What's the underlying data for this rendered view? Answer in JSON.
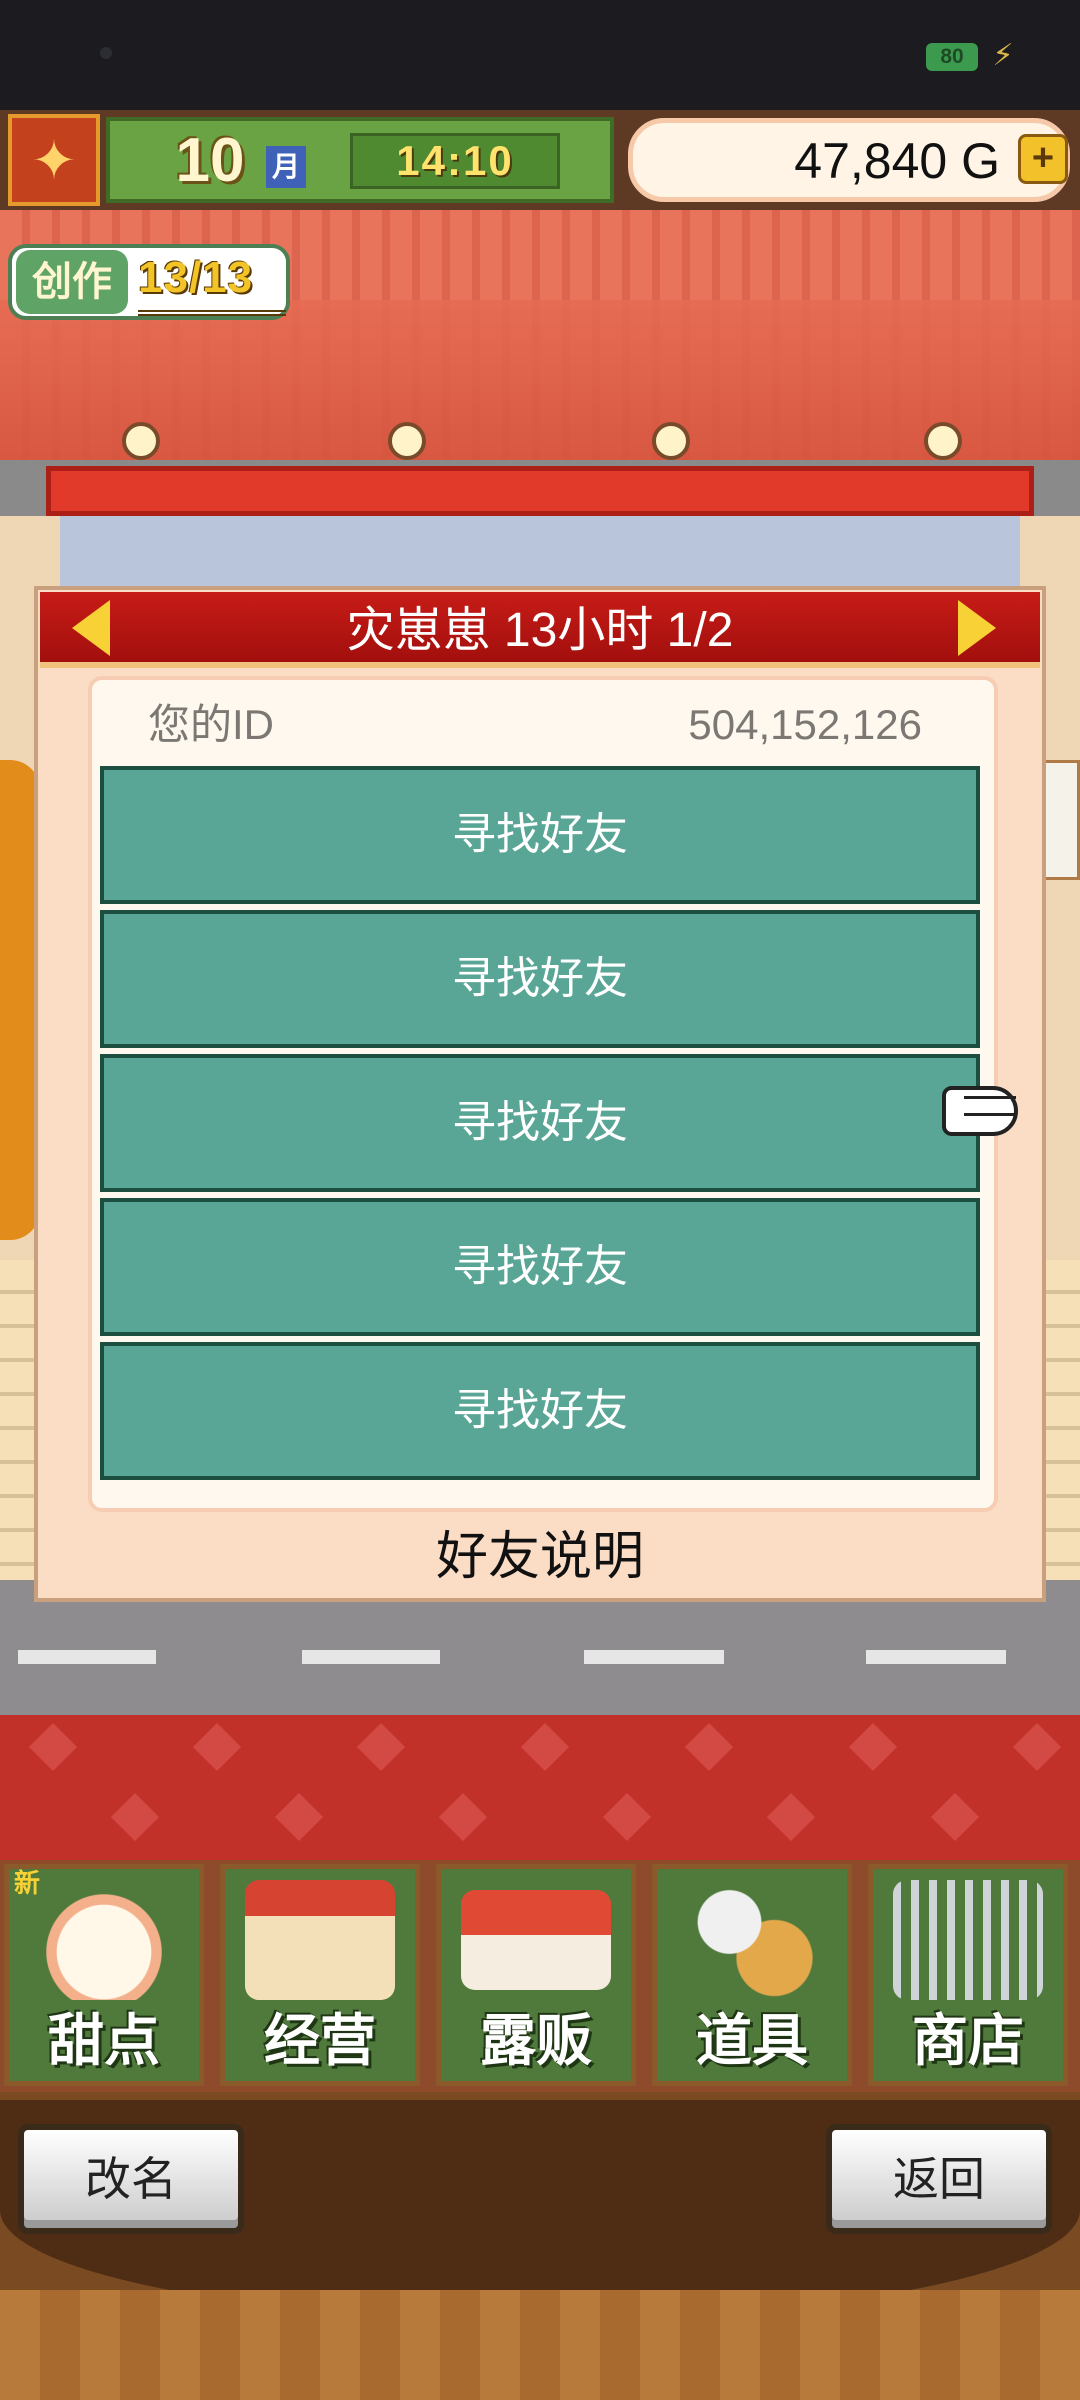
{
  "status_bar": {
    "battery_level": "80",
    "charging_icon": "lightning-icon"
  },
  "hud": {
    "season_icon": "maple-leaf-icon",
    "month_number": "10",
    "month_label": "月",
    "time": "14:10",
    "gold": "47,840 G",
    "add_gold_icon": "plus-icon"
  },
  "craft_counter": {
    "label": "创作",
    "value": "13/13"
  },
  "friend_panel": {
    "title": "灾崽崽  13小时 1/2",
    "prev_icon": "arrow-left-icon",
    "next_icon": "arrow-right-icon",
    "id_label": "您的ID",
    "id_value": "504,152,126",
    "slots": [
      "寻找好友",
      "寻找好友",
      "寻找好友",
      "寻找好友",
      "寻找好友"
    ],
    "help_label": "好友说明"
  },
  "pointer_icon": "pointing-hand-icon",
  "bottom_menu": {
    "new_badge": "新",
    "items": [
      {
        "label": "甜点",
        "icon": "cake-icon"
      },
      {
        "label": "经营",
        "icon": "shop-icon"
      },
      {
        "label": "露贩",
        "icon": "food-truck-icon"
      },
      {
        "label": "道具",
        "icon": "item-bag-icon"
      },
      {
        "label": "商店",
        "icon": "shopping-cart-icon"
      }
    ]
  },
  "footer": {
    "rename_label": "改名",
    "back_label": "返回"
  },
  "colors": {
    "panel_header": "#c71c17",
    "slot_fill": "#5aa696",
    "menu_tile": "#4f7a3c"
  }
}
